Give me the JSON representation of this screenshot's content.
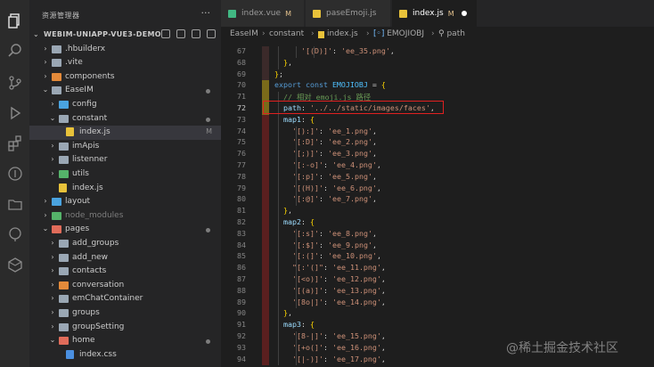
{
  "sidebar": {
    "title": "资源管理器",
    "more": "···",
    "project": "WEBIM-UNIAPP-VUE3-DEMO",
    "tree": [
      {
        "label": ".hbuilderx",
        "depth": 1,
        "chev": "›",
        "icon": "folder",
        "status": ""
      },
      {
        "label": ".vite",
        "depth": 1,
        "chev": "›",
        "icon": "folder",
        "status": ""
      },
      {
        "label": "components",
        "depth": 1,
        "chev": "›",
        "icon": "folder-orange",
        "status": ""
      },
      {
        "label": "EaseIM",
        "depth": 1,
        "chev": "⌄",
        "icon": "folder",
        "status": "dot"
      },
      {
        "label": "config",
        "depth": 2,
        "chev": "›",
        "icon": "folder-blue",
        "status": ""
      },
      {
        "label": "constant",
        "depth": 2,
        "chev": "⌄",
        "icon": "folder",
        "status": "dot"
      },
      {
        "label": "index.js",
        "depth": 3,
        "chev": "",
        "icon": "file-js",
        "status": "M",
        "selected": true
      },
      {
        "label": "imApis",
        "depth": 2,
        "chev": "›",
        "icon": "folder",
        "status": ""
      },
      {
        "label": "listenner",
        "depth": 2,
        "chev": "›",
        "icon": "folder",
        "status": ""
      },
      {
        "label": "utils",
        "depth": 2,
        "chev": "›",
        "icon": "folder-green",
        "status": ""
      },
      {
        "label": "index.js",
        "depth": 2,
        "chev": "",
        "icon": "file-js",
        "status": ""
      },
      {
        "label": "layout",
        "depth": 1,
        "chev": "›",
        "icon": "folder-blue",
        "status": ""
      },
      {
        "label": "node_modules",
        "depth": 1,
        "chev": "›",
        "icon": "folder-green",
        "status": "",
        "dim": true
      },
      {
        "label": "pages",
        "depth": 1,
        "chev": "⌄",
        "icon": "folder-red",
        "status": "dot"
      },
      {
        "label": "add_groups",
        "depth": 2,
        "chev": "›",
        "icon": "folder",
        "status": ""
      },
      {
        "label": "add_new",
        "depth": 2,
        "chev": "›",
        "icon": "folder",
        "status": ""
      },
      {
        "label": "contacts",
        "depth": 2,
        "chev": "›",
        "icon": "folder",
        "status": ""
      },
      {
        "label": "conversation",
        "depth": 2,
        "chev": "›",
        "icon": "folder-orange",
        "status": ""
      },
      {
        "label": "emChatContainer",
        "depth": 2,
        "chev": "›",
        "icon": "folder",
        "status": ""
      },
      {
        "label": "groups",
        "depth": 2,
        "chev": "›",
        "icon": "folder",
        "status": ""
      },
      {
        "label": "groupSetting",
        "depth": 2,
        "chev": "›",
        "icon": "folder",
        "status": ""
      },
      {
        "label": "home",
        "depth": 2,
        "chev": "⌄",
        "icon": "folder-red",
        "status": "dot"
      },
      {
        "label": "index.css",
        "depth": 3,
        "chev": "",
        "icon": "file-css",
        "status": ""
      }
    ]
  },
  "tabs": [
    {
      "label": "index.vue",
      "mod": "M",
      "icon_color": "#41b883",
      "active": false
    },
    {
      "label": "paseEmoji.js",
      "mod": "",
      "icon_color": "#e8c23a",
      "active": false
    },
    {
      "label": "index.js",
      "mod": "M",
      "icon_color": "#e8c23a",
      "active": true
    }
  ],
  "breadcrumbs": [
    "EaseIM",
    "constant",
    "index.js",
    "EMOJIOBJ",
    "path"
  ],
  "editor": {
    "current_line": 72,
    "lines": [
      {
        "n": 67,
        "indent": 3,
        "tokens": [
          [
            "t-str",
            "'[(D)]'"
          ],
          [
            "t-punct",
            ": "
          ],
          [
            "t-str",
            "'ee_35.png'"
          ],
          [
            "t-punct",
            ","
          ]
        ]
      },
      {
        "n": 68,
        "indent": 1,
        "tokens": [
          [
            "t-brace",
            "}"
          ],
          [
            "t-punct",
            ","
          ]
        ]
      },
      {
        "n": 69,
        "indent": 0,
        "tokens": [
          [
            "t-brace",
            "}"
          ],
          [
            "t-punct",
            ";"
          ]
        ]
      },
      {
        "n": 70,
        "indent": 0,
        "tokens": [
          [
            "t-kw",
            "export const "
          ],
          [
            "t-const",
            "EMOJIOBJ"
          ],
          [
            "t-punct",
            " = "
          ],
          [
            "t-brace",
            "{"
          ]
        ]
      },
      {
        "n": 71,
        "indent": 1,
        "tokens": [
          [
            "t-cmt",
            "// 相对 emoji.js 路径"
          ]
        ]
      },
      {
        "n": 72,
        "indent": 1,
        "tokens": [
          [
            "t-key",
            "path"
          ],
          [
            "t-punct",
            ": "
          ],
          [
            "t-str",
            "'../../static/images/faces'"
          ],
          [
            "t-punct",
            ","
          ]
        ]
      },
      {
        "n": 73,
        "indent": 1,
        "tokens": [
          [
            "t-key",
            "map1"
          ],
          [
            "t-punct",
            ": "
          ],
          [
            "t-brace",
            "{"
          ]
        ]
      },
      {
        "n": 74,
        "indent": 2,
        "tokens": [
          [
            "t-str",
            "'[):]'"
          ],
          [
            "t-punct",
            ": "
          ],
          [
            "t-str",
            "'ee_1.png'"
          ],
          [
            "t-punct",
            ","
          ]
        ]
      },
      {
        "n": 75,
        "indent": 2,
        "tokens": [
          [
            "t-str",
            "'[:D]'"
          ],
          [
            "t-punct",
            ": "
          ],
          [
            "t-str",
            "'ee_2.png'"
          ],
          [
            "t-punct",
            ","
          ]
        ]
      },
      {
        "n": 76,
        "indent": 2,
        "tokens": [
          [
            "t-str",
            "'[;)]'"
          ],
          [
            "t-punct",
            ": "
          ],
          [
            "t-str",
            "'ee_3.png'"
          ],
          [
            "t-punct",
            ","
          ]
        ]
      },
      {
        "n": 77,
        "indent": 2,
        "tokens": [
          [
            "t-str",
            "'[:-o]'"
          ],
          [
            "t-punct",
            ": "
          ],
          [
            "t-str",
            "'ee_4.png'"
          ],
          [
            "t-punct",
            ","
          ]
        ]
      },
      {
        "n": 78,
        "indent": 2,
        "tokens": [
          [
            "t-str",
            "'[:p]'"
          ],
          [
            "t-punct",
            ": "
          ],
          [
            "t-str",
            "'ee_5.png'"
          ],
          [
            "t-punct",
            ","
          ]
        ]
      },
      {
        "n": 79,
        "indent": 2,
        "tokens": [
          [
            "t-str",
            "'[(H)]'"
          ],
          [
            "t-punct",
            ": "
          ],
          [
            "t-str",
            "'ee_6.png'"
          ],
          [
            "t-punct",
            ","
          ]
        ]
      },
      {
        "n": 80,
        "indent": 2,
        "tokens": [
          [
            "t-str",
            "'[:@]'"
          ],
          [
            "t-punct",
            ": "
          ],
          [
            "t-str",
            "'ee_7.png'"
          ],
          [
            "t-punct",
            ","
          ]
        ]
      },
      {
        "n": 81,
        "indent": 1,
        "tokens": [
          [
            "t-brace",
            "}"
          ],
          [
            "t-punct",
            ","
          ]
        ]
      },
      {
        "n": 82,
        "indent": 1,
        "tokens": [
          [
            "t-key",
            "map2"
          ],
          [
            "t-punct",
            ": "
          ],
          [
            "t-brace",
            "{"
          ]
        ]
      },
      {
        "n": 83,
        "indent": 2,
        "tokens": [
          [
            "t-str",
            "'[:s]'"
          ],
          [
            "t-punct",
            ": "
          ],
          [
            "t-str",
            "'ee_8.png'"
          ],
          [
            "t-punct",
            ","
          ]
        ]
      },
      {
        "n": 84,
        "indent": 2,
        "tokens": [
          [
            "t-str",
            "'[:$]'"
          ],
          [
            "t-punct",
            ": "
          ],
          [
            "t-str",
            "'ee_9.png'"
          ],
          [
            "t-punct",
            ","
          ]
        ]
      },
      {
        "n": 85,
        "indent": 2,
        "tokens": [
          [
            "t-str",
            "'[:(]'"
          ],
          [
            "t-punct",
            ": "
          ],
          [
            "t-str",
            "'ee_10.png'"
          ],
          [
            "t-punct",
            ","
          ]
        ]
      },
      {
        "n": 86,
        "indent": 2,
        "tokens": [
          [
            "t-str",
            "\"[:'(]\""
          ],
          [
            "t-punct",
            ": "
          ],
          [
            "t-str",
            "'ee_11.png'"
          ],
          [
            "t-punct",
            ","
          ]
        ]
      },
      {
        "n": 87,
        "indent": 2,
        "tokens": [
          [
            "t-str",
            "'[<o)]'"
          ],
          [
            "t-punct",
            ": "
          ],
          [
            "t-str",
            "'ee_12.png'"
          ],
          [
            "t-punct",
            ","
          ]
        ]
      },
      {
        "n": 88,
        "indent": 2,
        "tokens": [
          [
            "t-str",
            "'[(a)]'"
          ],
          [
            "t-punct",
            ": "
          ],
          [
            "t-str",
            "'ee_13.png'"
          ],
          [
            "t-punct",
            ","
          ]
        ]
      },
      {
        "n": 89,
        "indent": 2,
        "tokens": [
          [
            "t-str",
            "'[8o|]'"
          ],
          [
            "t-punct",
            ": "
          ],
          [
            "t-str",
            "'ee_14.png'"
          ],
          [
            "t-punct",
            ","
          ]
        ]
      },
      {
        "n": 90,
        "indent": 1,
        "tokens": [
          [
            "t-brace",
            "}"
          ],
          [
            "t-punct",
            ","
          ]
        ]
      },
      {
        "n": 91,
        "indent": 1,
        "tokens": [
          [
            "t-key",
            "map3"
          ],
          [
            "t-punct",
            ": "
          ],
          [
            "t-brace",
            "{"
          ]
        ]
      },
      {
        "n": 92,
        "indent": 2,
        "tokens": [
          [
            "t-str",
            "'[8-|]'"
          ],
          [
            "t-punct",
            ": "
          ],
          [
            "t-str",
            "'ee_15.png'"
          ],
          [
            "t-punct",
            ","
          ]
        ]
      },
      {
        "n": 93,
        "indent": 2,
        "tokens": [
          [
            "t-str",
            "'[+o(]'"
          ],
          [
            "t-punct",
            ": "
          ],
          [
            "t-str",
            "'ee_16.png'"
          ],
          [
            "t-punct",
            ","
          ]
        ]
      },
      {
        "n": 94,
        "indent": 2,
        "tokens": [
          [
            "t-str",
            "'[|-)]'"
          ],
          [
            "t-punct",
            ": "
          ],
          [
            "t-str",
            "'ee_17.png'"
          ],
          [
            "t-punct",
            ","
          ]
        ]
      }
    ]
  },
  "watermark": "@稀土掘金技术社区",
  "colors": {
    "accent": "#007acc",
    "highlight_box": "#e02020",
    "modified": "#e2c08d"
  }
}
